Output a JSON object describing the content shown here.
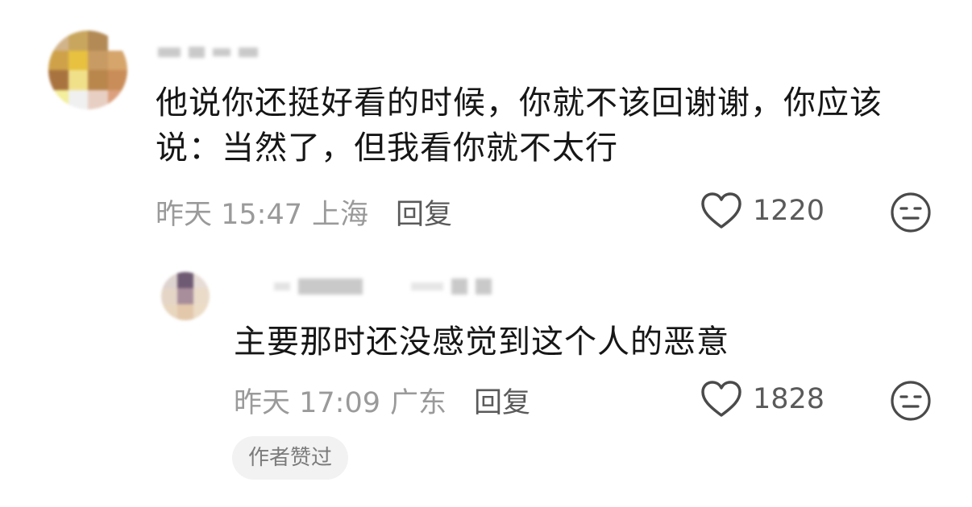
{
  "comments": [
    {
      "text": "他说你还挺好看的时候，你就不该回谢谢，你应该说：当然了，但我看你就不太行",
      "time": "昨天 15:47",
      "location": "上海",
      "reply_label": "回复",
      "likes": "1220"
    },
    {
      "text": "主要那时还没感觉到这个人的恶意",
      "time": "昨天 17:09",
      "location": "广东",
      "reply_label": "回复",
      "likes": "1828",
      "badge": "作者赞过"
    }
  ],
  "icons": {
    "like": "heart-outline-icon",
    "dislike": "meh-face-icon"
  },
  "colors": {
    "text": "#161616",
    "meta": "#9a9a9a",
    "action": "#5a5a5a",
    "badge_bg": "#f2f2f2"
  }
}
